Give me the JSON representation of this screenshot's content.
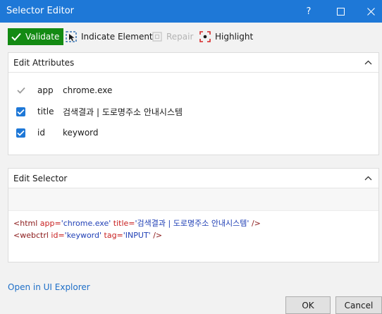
{
  "window": {
    "title": "Selector Editor",
    "help": "?",
    "accent": "#1e78d7"
  },
  "toolbar": {
    "validate": "Validate",
    "indicate": "Indicate Element",
    "repair": "Repair",
    "highlight": "Highlight"
  },
  "attributes": {
    "header": "Edit Attributes",
    "rows": [
      {
        "name": "app",
        "value": "chrome.exe",
        "checked": true,
        "enabled": false
      },
      {
        "name": "title",
        "value": "검색결과 | 도로명주소 안내시스템",
        "checked": true,
        "enabled": true
      },
      {
        "name": "id",
        "value": "keyword",
        "checked": true,
        "enabled": true
      }
    ]
  },
  "selector": {
    "header": "Edit Selector",
    "line1": {
      "open": "<html",
      "a1": " app=",
      "v1": "'chrome.exe'",
      "a2": " title=",
      "v2": "'검색결과 | 도로명주소 안내시스템'",
      "close": " />"
    },
    "line2": {
      "open": "<webctrl",
      "a1": " id=",
      "v1": "'keyword'",
      "a2": " tag=",
      "v2": "'INPUT'",
      "close": " />"
    }
  },
  "footer": {
    "link": "Open in UI Explorer",
    "ok": "OK",
    "cancel": "Cancel"
  }
}
